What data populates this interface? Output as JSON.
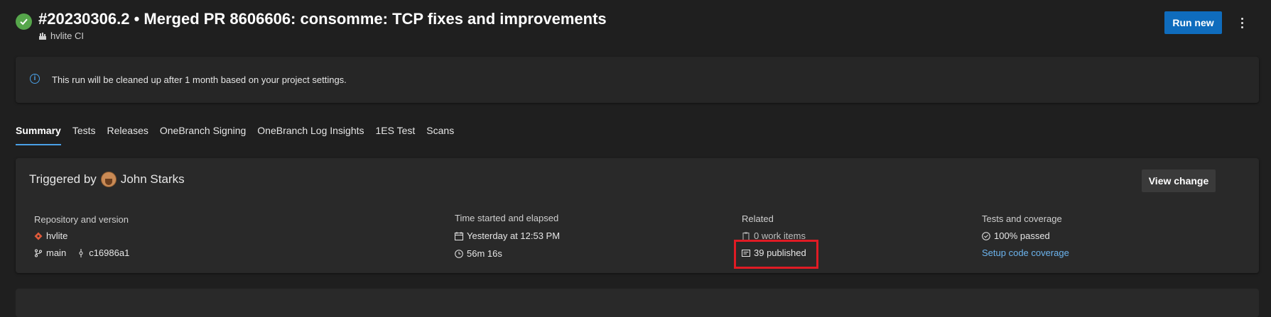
{
  "header": {
    "title": "#20230306.2 • Merged PR 8606606: consomme: TCP fixes and improvements",
    "pipeline": "hvlite CI",
    "run_new_label": "Run new"
  },
  "banner": {
    "text": "This run will be cleaned up after 1 month based on your project settings."
  },
  "tabs": [
    {
      "label": "Summary",
      "active": true
    },
    {
      "label": "Tests"
    },
    {
      "label": "Releases"
    },
    {
      "label": "OneBranch Signing"
    },
    {
      "label": "OneBranch Log Insights"
    },
    {
      "label": "1ES Test"
    },
    {
      "label": "Scans"
    }
  ],
  "summary": {
    "triggered_by_label": "Triggered by",
    "user_name": "John Starks",
    "view_change_label": "View change",
    "repo": {
      "heading": "Repository and version",
      "name": "hvlite",
      "branch": "main",
      "commit": "c16986a1"
    },
    "time": {
      "heading": "Time started and elapsed",
      "started": "Yesterday at 12:53 PM",
      "elapsed": "56m 16s"
    },
    "related": {
      "heading": "Related",
      "work_items": "0 work items",
      "published": "39 published"
    },
    "tests": {
      "heading": "Tests and coverage",
      "passed": "100% passed",
      "coverage_link": "Setup code coverage"
    }
  },
  "colors": {
    "success": "#56a64b",
    "accent": "#0f6cbd",
    "link": "#6cb4ee",
    "highlight": "#e01b24"
  }
}
